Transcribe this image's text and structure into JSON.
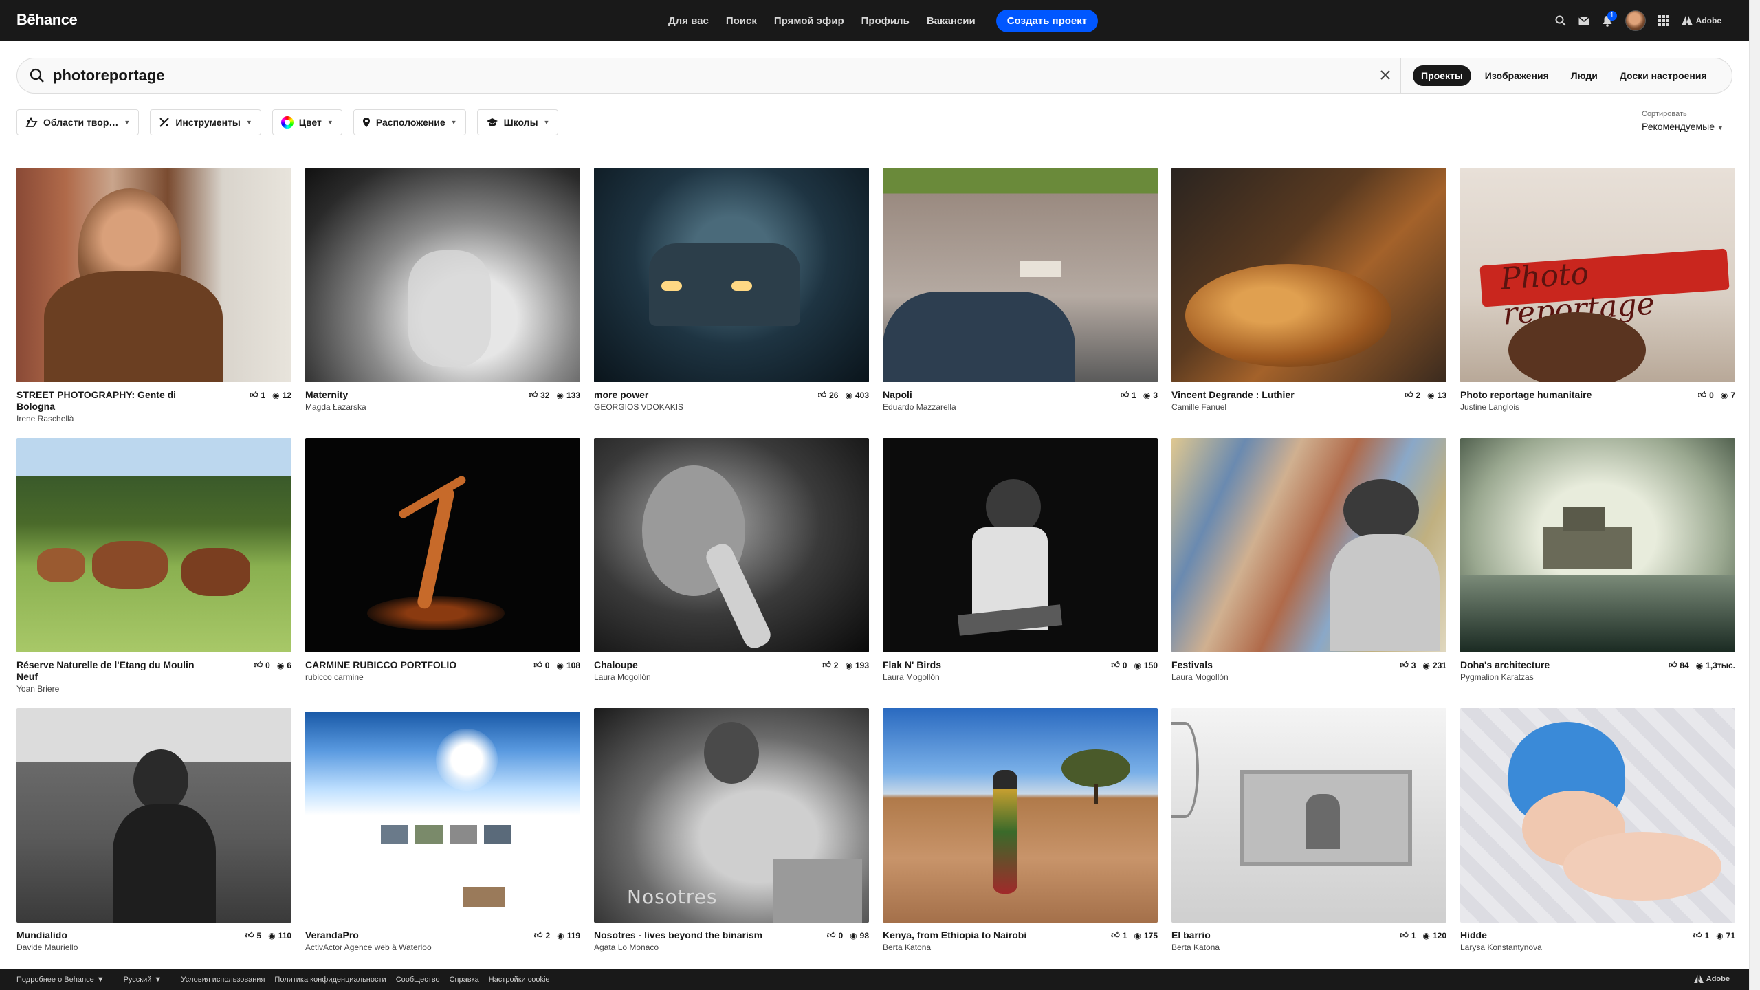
{
  "logo": "Bēhance",
  "nav": [
    "Для вас",
    "Поиск",
    "Прямой эфир",
    "Профиль",
    "Вакансии"
  ],
  "create_button": "Создать проект",
  "notification_count": "1",
  "adobe_label": "Adobe",
  "search": {
    "value": "photoreportage"
  },
  "scope_tabs": [
    "Проекты",
    "Изображения",
    "Люди",
    "Доски настроения"
  ],
  "filters": [
    "Области твор…",
    "Инструменты",
    "Цвет",
    "Расположение",
    "Школы"
  ],
  "sort": {
    "label": "Сортировать",
    "value": "Рекомендуемые"
  },
  "projects": [
    {
      "title": "STREET PHOTOGRAPHY: Gente di Bologna",
      "owner": "Irene Raschellà",
      "likes": "1",
      "views": "12"
    },
    {
      "title": "Maternity",
      "owner": "Magda Łazarska",
      "likes": "32",
      "views": "133"
    },
    {
      "title": "more power",
      "owner": "GEORGIOS VDOKAKIS",
      "likes": "26",
      "views": "403"
    },
    {
      "title": "Napoli",
      "owner": "Eduardo Mazzarella",
      "likes": "1",
      "views": "3"
    },
    {
      "title": "Vincent Degrande : Luthier",
      "owner": "Camille Fanuel",
      "likes": "2",
      "views": "13"
    },
    {
      "title": "Photo reportage humanitaire",
      "owner": "Justine Langlois",
      "likes": "0",
      "views": "7"
    },
    {
      "title": "Réserve Naturelle de l'Etang du Moulin Neuf",
      "owner": "Yoan Briere",
      "likes": "0",
      "views": "6"
    },
    {
      "title": "CARMINE RUBICCO PORTFOLIO",
      "owner": "rubicco carmine",
      "likes": "0",
      "views": "108"
    },
    {
      "title": "Chaloupe",
      "owner": "Laura Mogollón",
      "likes": "2",
      "views": "193"
    },
    {
      "title": "Flak N' Birds",
      "owner": "Laura Mogollón",
      "likes": "0",
      "views": "150"
    },
    {
      "title": "Festivals",
      "owner": "Laura Mogollón",
      "likes": "3",
      "views": "231"
    },
    {
      "title": "Doha's architecture",
      "owner": "Pygmalion Karatzas",
      "likes": "84",
      "views": "1,3тыс."
    },
    {
      "title": "Mundialido",
      "owner": "Davide Mauriello",
      "likes": "5",
      "views": "110"
    },
    {
      "title": "VerandaPro",
      "owner": "ActivActor Agence web à Waterloo",
      "likes": "2",
      "views": "119"
    },
    {
      "title": "Nosotres - lives beyond the binarism",
      "owner": "Agata Lo Monaco",
      "likes": "0",
      "views": "98"
    },
    {
      "title": "Kenya, from Ethiopia to Nairobi",
      "owner": "Berta Katona",
      "likes": "1",
      "views": "175"
    },
    {
      "title": "El barrio",
      "owner": "Berta Katona",
      "likes": "1",
      "views": "120"
    },
    {
      "title": "Hidde",
      "owner": "Larysa Konstantynova",
      "likes": "1",
      "views": "71"
    }
  ],
  "thumb_text": {
    "photo_reportage": "Photo reportage",
    "nosotres": "Nosotres"
  },
  "footer": [
    "Подробнее о Behance",
    "Русский",
    "Условия использования",
    "Политика конфиденциальности",
    "Сообщество",
    "Справка",
    "Настройки cookie"
  ]
}
